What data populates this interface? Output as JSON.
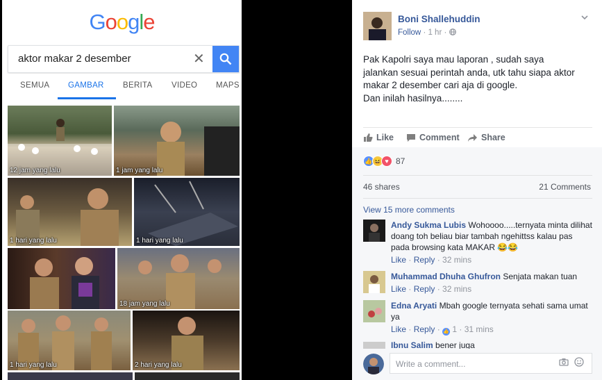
{
  "google": {
    "logo": "Google",
    "query": "aktor makar 2 desember",
    "tabs": [
      "SEMUA",
      "GAMBAR",
      "BERITA",
      "VIDEO",
      "MAPS"
    ],
    "active_tab": "GAMBAR",
    "images": [
      {
        "caption": "12 jam yang lalu"
      },
      {
        "caption": "1 jam yang lalu"
      },
      {
        "caption": "1 hari yang lalu"
      },
      {
        "caption": "1 hari yang lalu"
      },
      {
        "caption": "18 jam yang lalu"
      },
      {
        "caption": "1 hari yang lalu"
      },
      {
        "caption": "2 hari yang lalu"
      }
    ]
  },
  "post": {
    "author": "Boni Shallehuddin",
    "follow": "Follow",
    "time": "1 hr",
    "text_lines": [
      "Pak Kapolri saya mau laporan , sudah saya",
      "jalankan sesuai perintah anda, utk tahu siapa aktor",
      "makar 2 desember cari aja di google.",
      "Dan inilah hasilnya........"
    ],
    "actions": {
      "like": "Like",
      "comment": "Comment",
      "share": "Share"
    },
    "reaction_count": "87",
    "shares": "46 shares",
    "comments_count": "21 Comments",
    "view_more": "View 15 more comments",
    "comments": [
      {
        "name": "Andy Sukma Lubis",
        "text": "Wohoooo.....ternyata minta dilihat doang toh beliau biar tambah ngehittss kalau pas pada browsing kata MAKAR",
        "emoji": "😂😂",
        "like": "Like",
        "reply": "Reply",
        "time": "32 mins",
        "likes": ""
      },
      {
        "name": "Muhammad Dhuha Ghufron",
        "text": "Senjata makan tuan",
        "emoji": "",
        "like": "Like",
        "reply": "Reply",
        "time": "32 mins",
        "likes": ""
      },
      {
        "name": "Edna Aryati",
        "text": "Mbah google ternyata sehati sama umat ya",
        "emoji": "",
        "like": "Like",
        "reply": "Reply",
        "time": "31 mins",
        "likes": "1"
      },
      {
        "name": "Ibnu Salim",
        "text": "bener juga",
        "emoji": "",
        "like": "",
        "reply": "",
        "time": "",
        "likes": ""
      }
    ],
    "write_placeholder": "Write a comment..."
  },
  "colors": {
    "fb_link": "#365899",
    "google_blue": "#4285f4",
    "like_blue": "#5890ff",
    "love_red": "#f25268",
    "haha_yellow": "#f7c947"
  }
}
